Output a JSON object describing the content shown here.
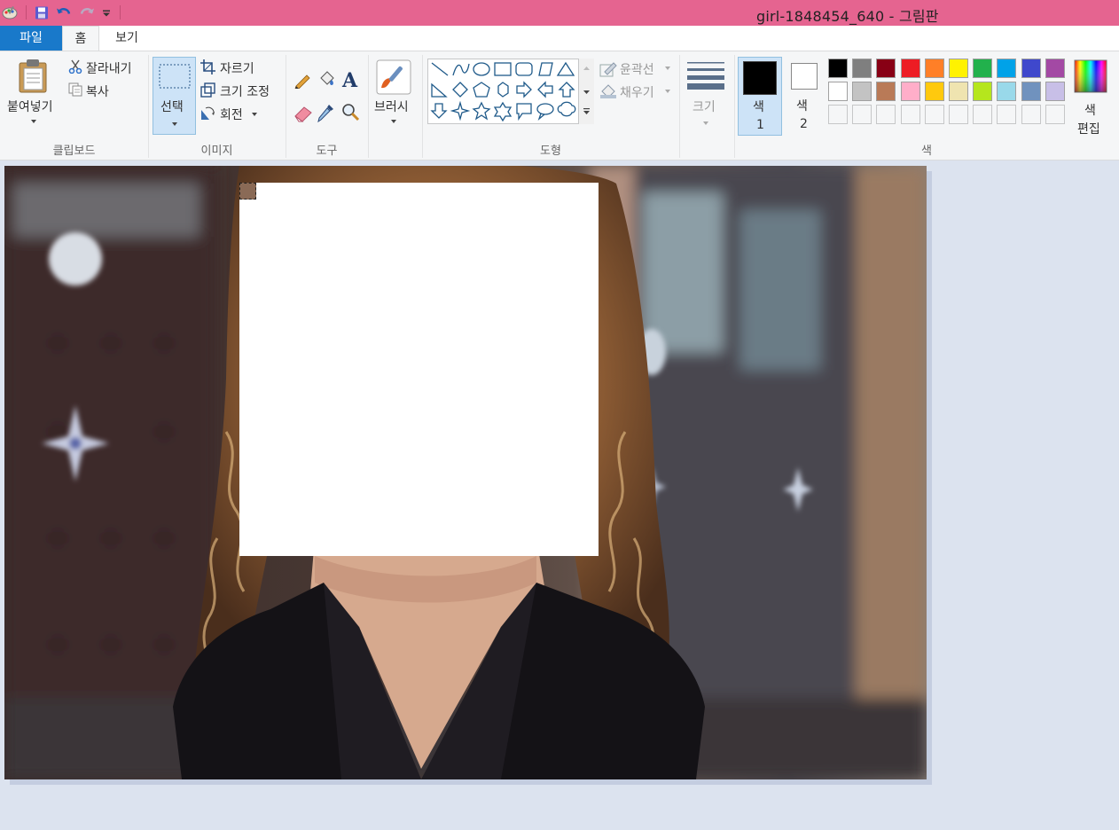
{
  "window": {
    "title": "girl-1848454_640 - 그림판"
  },
  "tabs": {
    "file": "파일",
    "home": "홈",
    "view": "보기"
  },
  "clipboard": {
    "paste": "붙여넣기",
    "cut": "잘라내기",
    "copy": "복사",
    "group": "클립보드"
  },
  "image": {
    "select": "선택",
    "crop": "자르기",
    "resize": "크기 조정",
    "rotate": "회전",
    "group": "이미지"
  },
  "tools": {
    "group": "도구",
    "brush": "브러시"
  },
  "shapes": {
    "outline": "윤곽선",
    "fill": "채우기",
    "group": "도형"
  },
  "size": {
    "label": "크기"
  },
  "colors": {
    "color1_label": "색",
    "color1_num": "1",
    "color2_label": "색",
    "color2_num": "2",
    "edit_label1": "색",
    "edit_label2": "편집",
    "group": "색",
    "color1_value": "#000000",
    "color2_value": "#ffffff",
    "palette_row1": [
      "#000000",
      "#7f7f7f",
      "#880015",
      "#ed1c24",
      "#ff7f27",
      "#fff200",
      "#22b14c",
      "#00a2e8",
      "#3f48cc",
      "#a349a4"
    ],
    "palette_row2": [
      "#ffffff",
      "#c3c3c3",
      "#b97a57",
      "#ffaec9",
      "#ffc90e",
      "#efe4b0",
      "#b5e61d",
      "#99d9ea",
      "#7092be",
      "#c8bfe7"
    ],
    "palette_row3": [
      "#f5f6f7",
      "#f5f6f7",
      "#f5f6f7",
      "#f5f6f7",
      "#f5f6f7",
      "#f5f6f7",
      "#f5f6f7",
      "#f5f6f7",
      "#f5f6f7",
      "#f5f6f7"
    ]
  },
  "icons": [
    "paint-app-icon",
    "save-icon",
    "undo-icon",
    "redo-icon",
    "customize-qa-icon",
    "paste-icon",
    "cut-icon",
    "copy-icon",
    "select-icon",
    "crop-icon",
    "resize-icon",
    "rotate-icon",
    "pencil-icon",
    "fill-icon",
    "text-icon",
    "eraser-icon",
    "color-picker-icon",
    "magnifier-icon",
    "brush-icon",
    "outline-icon",
    "fill-shape-icon",
    "size-icon",
    "edit-colors-icon"
  ]
}
